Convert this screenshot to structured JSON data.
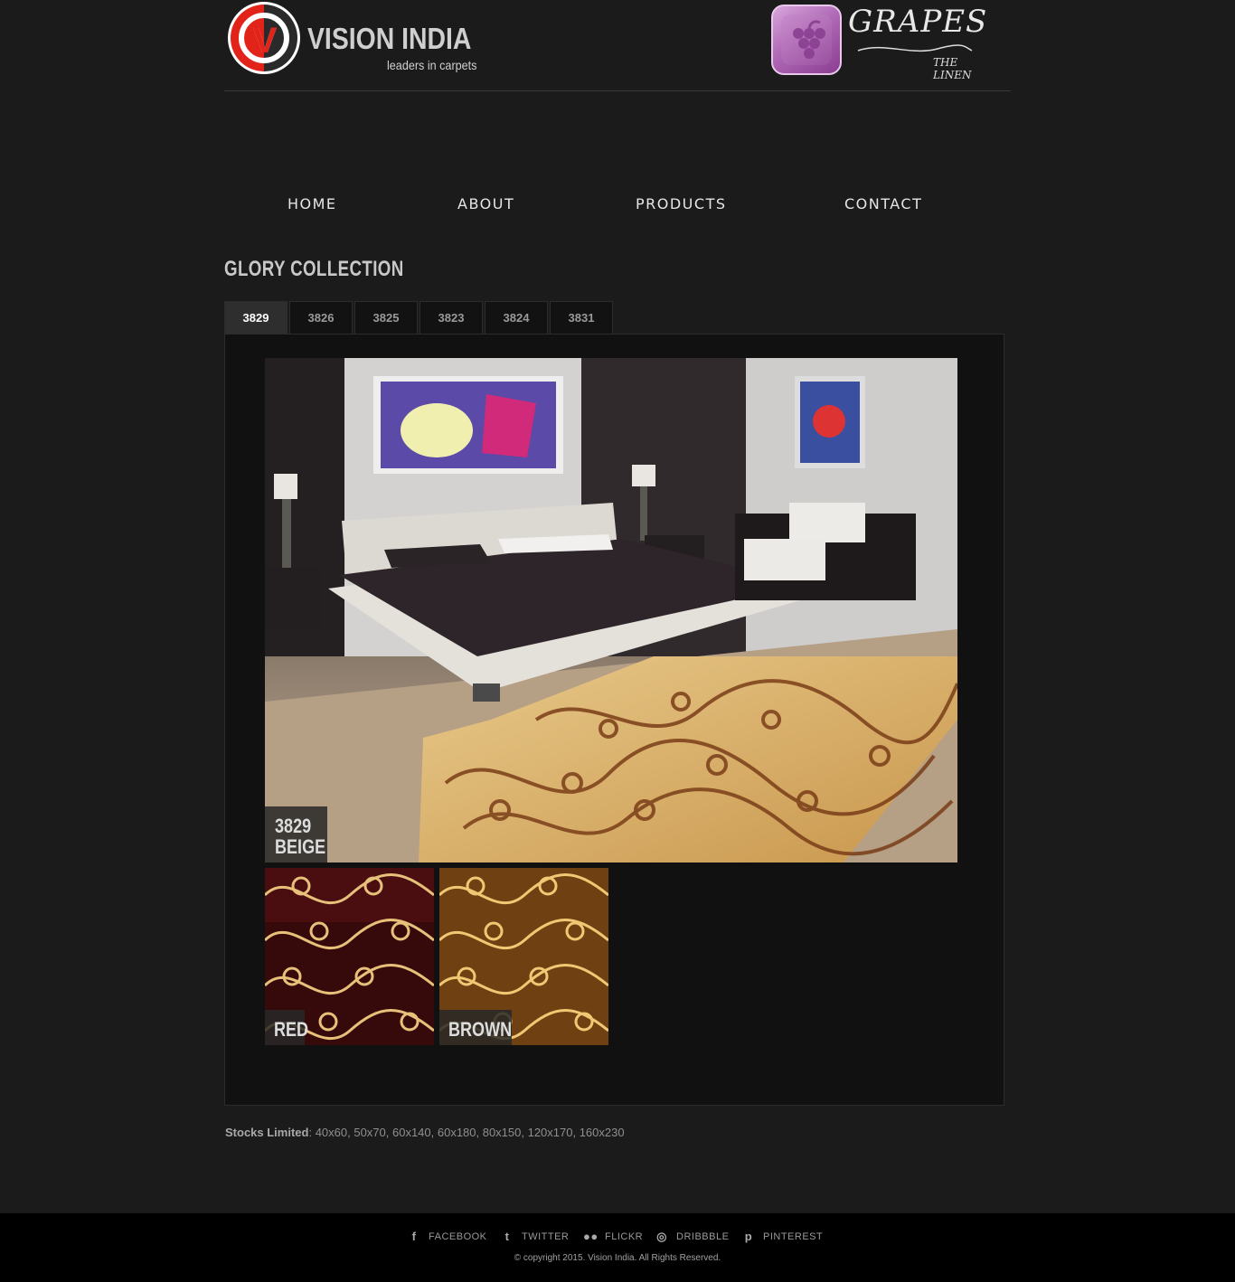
{
  "header": {
    "brand_name": "VISION INDIA",
    "brand_tagline": "leaders in carpets",
    "partner_name": "GRAPES",
    "partner_tagline": "THE LINEN"
  },
  "nav": {
    "items": [
      "HOME",
      "ABOUT",
      "PRODUCTS",
      "CONTACT"
    ]
  },
  "collection": {
    "title": "GLORY COLLECTION",
    "tabs": [
      "3829",
      "3826",
      "3825",
      "3823",
      "3824",
      "3831"
    ],
    "active_tab": "3829",
    "main_caption_line1": "3829",
    "main_caption_line2": "BEIGE",
    "thumbs": [
      "RED",
      "BROWN"
    ]
  },
  "stock": {
    "label": "Stocks Limited",
    "sizes": ": 40x60, 50x70, 60x140, 60x180, 80x150, 120x170, 160x230"
  },
  "footer": {
    "social": [
      {
        "label": "FACEBOOK",
        "icon": "facebook-icon"
      },
      {
        "label": "TWITTER",
        "icon": "twitter-icon"
      },
      {
        "label": "FLICKR",
        "icon": "flickr-icon"
      },
      {
        "label": "DRIBBBLE",
        "icon": "dribbble-icon"
      },
      {
        "label": "PINTEREST",
        "icon": "pinterest-icon"
      }
    ],
    "copyright": "© copyright 2015. Vision India. All Rights Reserved."
  },
  "colors": {
    "background": "#1b1b1b",
    "panel": "#111111",
    "brand_red": "#e2231a",
    "grape_purple": "#a55aab"
  }
}
